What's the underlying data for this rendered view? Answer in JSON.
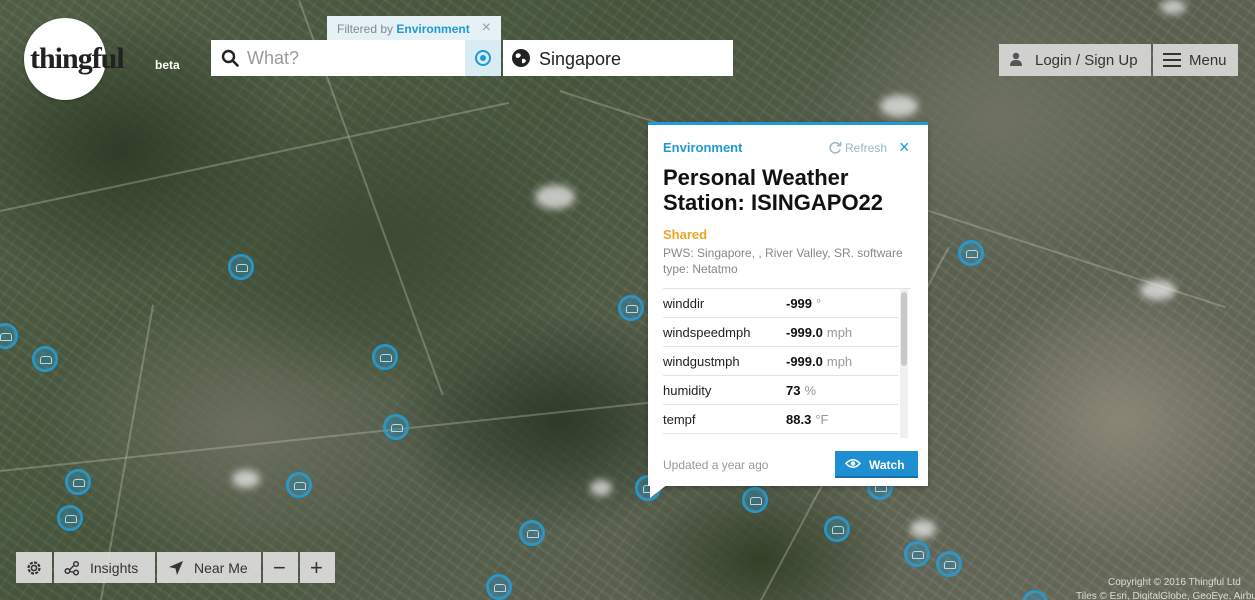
{
  "logo": {
    "text": "thingful",
    "badge": "beta"
  },
  "search": {
    "filter_prefix": "Filtered by",
    "filter_value": "Environment",
    "filter_close": "×",
    "what_placeholder": "What?",
    "location": "Singapore"
  },
  "header": {
    "login": "Login / Sign Up",
    "menu": "Menu"
  },
  "popup": {
    "category": "Environment",
    "refresh": "Refresh",
    "close": "×",
    "title": "Personal Weather Station: ISINGAPO22",
    "status": "Shared",
    "description": "PWS: Singapore, , River Valley, SR. software type: Netatmo",
    "readings": [
      {
        "key": "winddir",
        "value": "-999",
        "unit": "°"
      },
      {
        "key": "windspeedmph",
        "value": "-999.0",
        "unit": "mph"
      },
      {
        "key": "windgustmph",
        "value": "-999.0",
        "unit": "mph"
      },
      {
        "key": "humidity",
        "value": "73",
        "unit": "%"
      },
      {
        "key": "tempf",
        "value": "88.3",
        "unit": "°F"
      }
    ],
    "updated": "Updated a year ago",
    "watch": "Watch"
  },
  "toolbar": {
    "insights": "Insights",
    "near_me": "Near Me",
    "zoom_out": "−",
    "zoom_in": "+"
  },
  "footer": {
    "copyright": "Copyright © 2016 Thingful Ltd",
    "tiles": "Tiles © Esri, DigitalGlobe, GeoEye, Airbus DS"
  },
  "colors": {
    "accent": "#1e9ad6",
    "status": "#f0a322"
  }
}
